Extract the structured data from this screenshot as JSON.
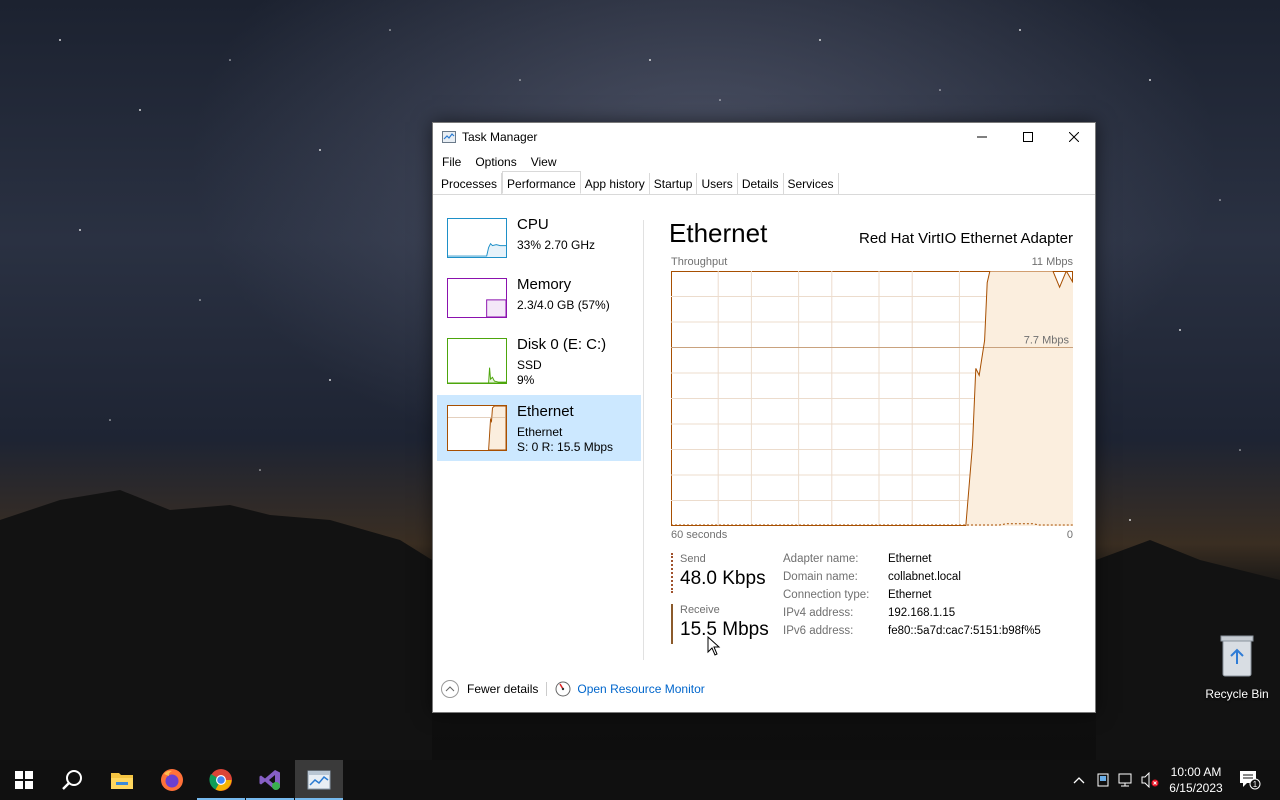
{
  "window": {
    "title": "Task Manager",
    "menu": [
      "File",
      "Options",
      "View"
    ],
    "tabs": [
      "Processes",
      "Performance",
      "App history",
      "Startup",
      "Users",
      "Details",
      "Services"
    ],
    "active_tab": "Performance"
  },
  "perf_list": [
    {
      "name": "CPU",
      "sub1": "33%  2.70 GHz",
      "sub2": "",
      "sub3": "",
      "color": "#1e90c8"
    },
    {
      "name": "Memory",
      "sub1": "2.3/4.0 GB (57%)",
      "sub2": "",
      "sub3": "",
      "color": "#8b12ae"
    },
    {
      "name": "Disk 0 (E: C:)",
      "sub1": "SSD",
      "sub2": "9%",
      "sub3": "",
      "color": "#4da60c"
    },
    {
      "name": "Ethernet",
      "sub1": "Ethernet",
      "sub2": "S: 0  R: 15.5 Mbps",
      "sub3": "",
      "color": "#a74f01"
    }
  ],
  "detail": {
    "heading": "Ethernet",
    "adapter": "Red Hat VirtIO Ethernet Adapter",
    "throughput_label": "Throughput",
    "max_label": "11 Mbps",
    "mid_label": "7.7 Mbps",
    "time_left": "60 seconds",
    "time_right": "0",
    "send_label": "Send",
    "send_value": "48.0 Kbps",
    "receive_label": "Receive",
    "receive_value": "15.5 Mbps",
    "props": [
      {
        "k": "Adapter name:",
        "v": "Ethernet"
      },
      {
        "k": "Domain name:",
        "v": "collabnet.local"
      },
      {
        "k": "Connection type:",
        "v": "Ethernet"
      },
      {
        "k": "IPv4 address:",
        "v": "192.168.1.15"
      },
      {
        "k": "IPv6 address:",
        "v": "fe80::5a7d:cac7:5151:b98f%5"
      }
    ]
  },
  "footer": {
    "fewer": "Fewer details",
    "resource_monitor": "Open Resource Monitor"
  },
  "desktop": {
    "recycle_bin": "Recycle Bin"
  },
  "clock": {
    "time": "10:00 AM",
    "date": "6/15/2023"
  },
  "notification_count": "1",
  "chart_data": {
    "type": "area",
    "title": "Throughput",
    "xlabel": "60 seconds",
    "ylim": [
      0,
      11
    ],
    "x": [
      0,
      44,
      45,
      45.5,
      46,
      46.8,
      47.2,
      47.6,
      48,
      49,
      50,
      51,
      52,
      53,
      54,
      55,
      56,
      57,
      58,
      59,
      60
    ],
    "series": [
      {
        "name": "Receive",
        "values": [
          0,
          0,
          3.5,
          6.8,
          6.5,
          8.0,
          10.5,
          11,
          11,
          11,
          11,
          11,
          11,
          11,
          11,
          11,
          11,
          11,
          10.3,
          11,
          10.5
        ]
      },
      {
        "name": "Send",
        "values": [
          0,
          0,
          0,
          0,
          0,
          0,
          0,
          0,
          0,
          0,
          0.05,
          0.05,
          0.05,
          0.05,
          0.05,
          0,
          0,
          0,
          0,
          0,
          0
        ]
      }
    ]
  }
}
